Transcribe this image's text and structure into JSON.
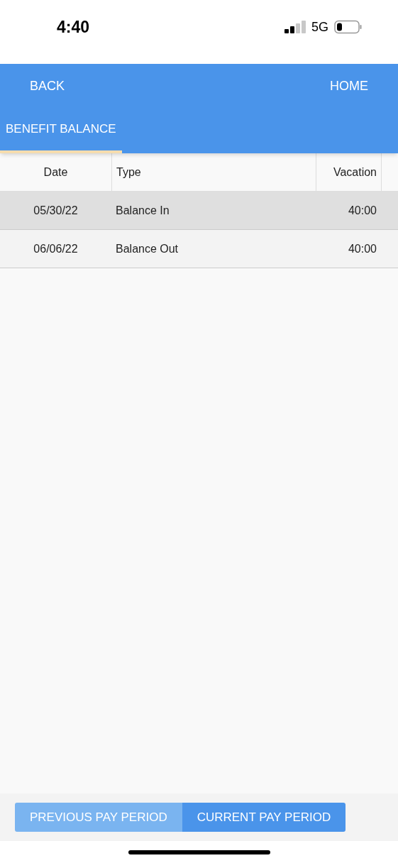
{
  "status_bar": {
    "time": "4:40",
    "network": "5G"
  },
  "nav": {
    "back": "BACK",
    "home": "HOME"
  },
  "tabs": [
    {
      "label": "BENEFIT BALANCE",
      "selected": true
    }
  ],
  "table": {
    "columns": [
      "Date",
      "Type",
      "Vacation"
    ],
    "rows": [
      {
        "cells": [
          "05/30/22",
          "Balance In",
          "40:00"
        ],
        "selected": true
      },
      {
        "cells": [
          "06/06/22",
          "Balance Out",
          "40:00"
        ],
        "selected": false
      }
    ]
  },
  "periods": [
    {
      "label": "PREVIOUS PAY PERIOD",
      "selected": false
    },
    {
      "label": "CURRENT PAY PERIOD",
      "selected": true
    }
  ]
}
